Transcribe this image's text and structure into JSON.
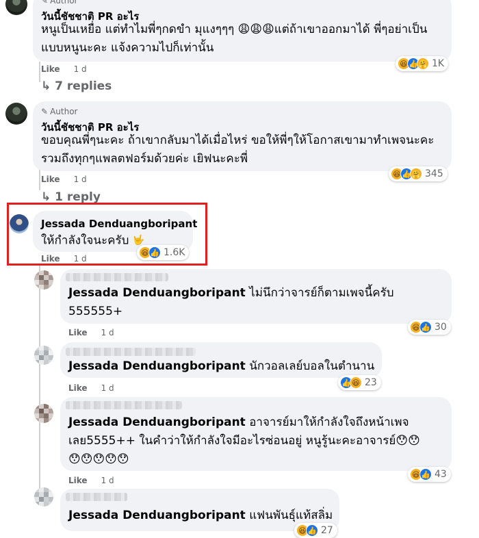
{
  "comments": [
    {
      "badge": "Author",
      "author": "วันนี้ชัชชาติ PR อะไร",
      "text": "หนูเป็นเหยื่อ แต่ทำไมพี่ๆกดขำ มุแงๆๆๆ 😩😩😩แต่ถ้าเขาออกมาได้ พี่ๆอย่าเป็นแบบหนูนะคะ แจ้งความไปก็เท่านั้น",
      "like_label": "Like",
      "time": "1 d",
      "reaction_count": "1K",
      "replies_label": "7 replies"
    },
    {
      "badge": "Author",
      "author": "วันนี้ชัชชาติ PR อะไร",
      "text": "ขอบคุณพี่ๆนะคะ ถ้าเขากลับมาได้เมื่อไหร่ ขอให้พี่ๆให้โอกาสเขามาทำเพจนะคะ รวมถึงทุกๆแพลตฟอร์มด้วยค่ะ เยิฟนะคะพี่",
      "like_label": "Like",
      "time": "1 d",
      "reaction_count": "345",
      "replies_label": "1 reply"
    },
    {
      "author": "Jessada Denduangboripant",
      "text": "ให้กำลังใจนะครับ",
      "like_label": "Like",
      "time": "1 d",
      "reaction_count": "1.6K"
    }
  ],
  "replies": [
    {
      "mention": "Jessada Denduangboripant",
      "text": "ไม่นึกว่าจารย์ก็ตามเพจนี้ครับ",
      "text2": "555555+",
      "like_label": "Like",
      "time": "1 d",
      "reaction_count": "30"
    },
    {
      "mention": "Jessada Denduangboripant",
      "text": "นักวอลเลย์บอลในตำนาน",
      "like_label": "Like",
      "time": "1 d",
      "reaction_count": "23"
    },
    {
      "mention": "Jessada Denduangboripant",
      "text": "อาจารย์มาให้กำลังใจถึงหน้าเพจ",
      "text2": "เลย5555++ ในคำว่าให้กำลังใจมีอะไรซ่อนอยู่ หนูรู้นะคะอาจารย์😯😯",
      "text3": "😯😯😯😯😯",
      "like_label": "Like",
      "time": "1 d",
      "reaction_count": "43"
    },
    {
      "mention": "Jessada Denduangboripant",
      "text": "แฟนพันธุ์แท้สลิ่ม",
      "reaction_count": "27"
    }
  ],
  "icons": {
    "reply_arrow": "reply-arrow-icon",
    "pencil": "pencil-icon",
    "haha": "haha-reaction-icon",
    "like": "like-reaction-icon",
    "care": "care-reaction-icon"
  },
  "colors": {
    "highlight": "#e0201f",
    "bubble": "#f0f2f5",
    "meta": "#65676b",
    "like_blue": "#1b74e4"
  }
}
